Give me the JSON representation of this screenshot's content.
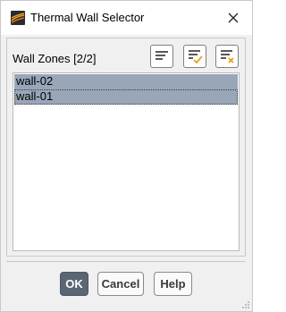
{
  "window": {
    "title": "Thermal Wall Selector",
    "icons": {
      "app": "fluent-app-icon",
      "close": "close-icon"
    }
  },
  "wall_zones": {
    "label": "Wall Zones  [2/2]",
    "toolbar": [
      {
        "name": "deselect-all-button",
        "icon": "list-lines-icon"
      },
      {
        "name": "select-all-button",
        "icon": "list-check-icon"
      },
      {
        "name": "clear-button",
        "icon": "list-x-icon"
      }
    ],
    "items": [
      {
        "label": "wall-02",
        "selected": true
      },
      {
        "label": "wall-01",
        "selected": true,
        "focused": true
      }
    ]
  },
  "buttons": {
    "ok": "OK",
    "cancel": "Cancel",
    "help": "Help"
  },
  "colors": {
    "selection": "#98a6b8",
    "primary_button": "#5b6675",
    "check_accent": "#e8a317"
  }
}
